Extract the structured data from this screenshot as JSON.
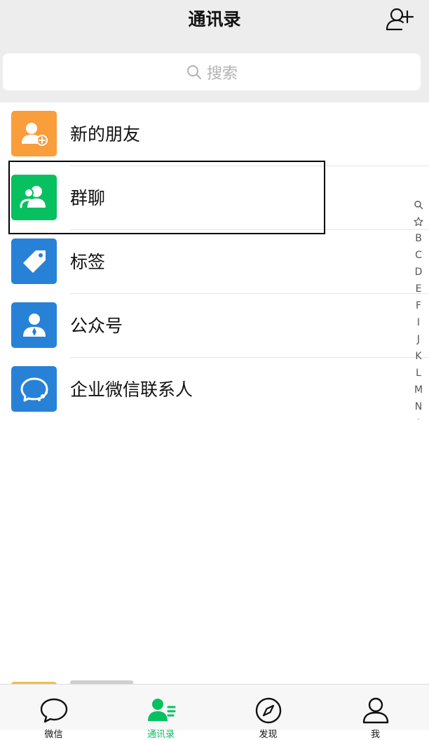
{
  "header": {
    "title": "通讯录"
  },
  "search": {
    "placeholder": "搜索"
  },
  "list": {
    "items": [
      {
        "label": "新的朋友",
        "color": "#fa9d3b"
      },
      {
        "label": "群聊",
        "color": "#07c160"
      },
      {
        "label": "标签",
        "color": "#2782d7"
      },
      {
        "label": "公众号",
        "color": "#2782d7"
      },
      {
        "label": "企业微信联系人",
        "color": "#2782d7"
      }
    ]
  },
  "index": {
    "letters": [
      "B",
      "C",
      "D",
      "E",
      "F",
      "I",
      "J",
      "K",
      "L",
      "M",
      "N",
      "O"
    ]
  },
  "tabs": [
    {
      "label": "微信",
      "icon": "chat-bubble-icon",
      "active": false
    },
    {
      "label": "通讯录",
      "icon": "contacts-icon",
      "active": true
    },
    {
      "label": "发现",
      "icon": "compass-icon",
      "active": false
    },
    {
      "label": "我",
      "icon": "person-icon",
      "active": false
    }
  ],
  "colors": {
    "accent": "#07c160",
    "header_bg": "#ededed"
  }
}
